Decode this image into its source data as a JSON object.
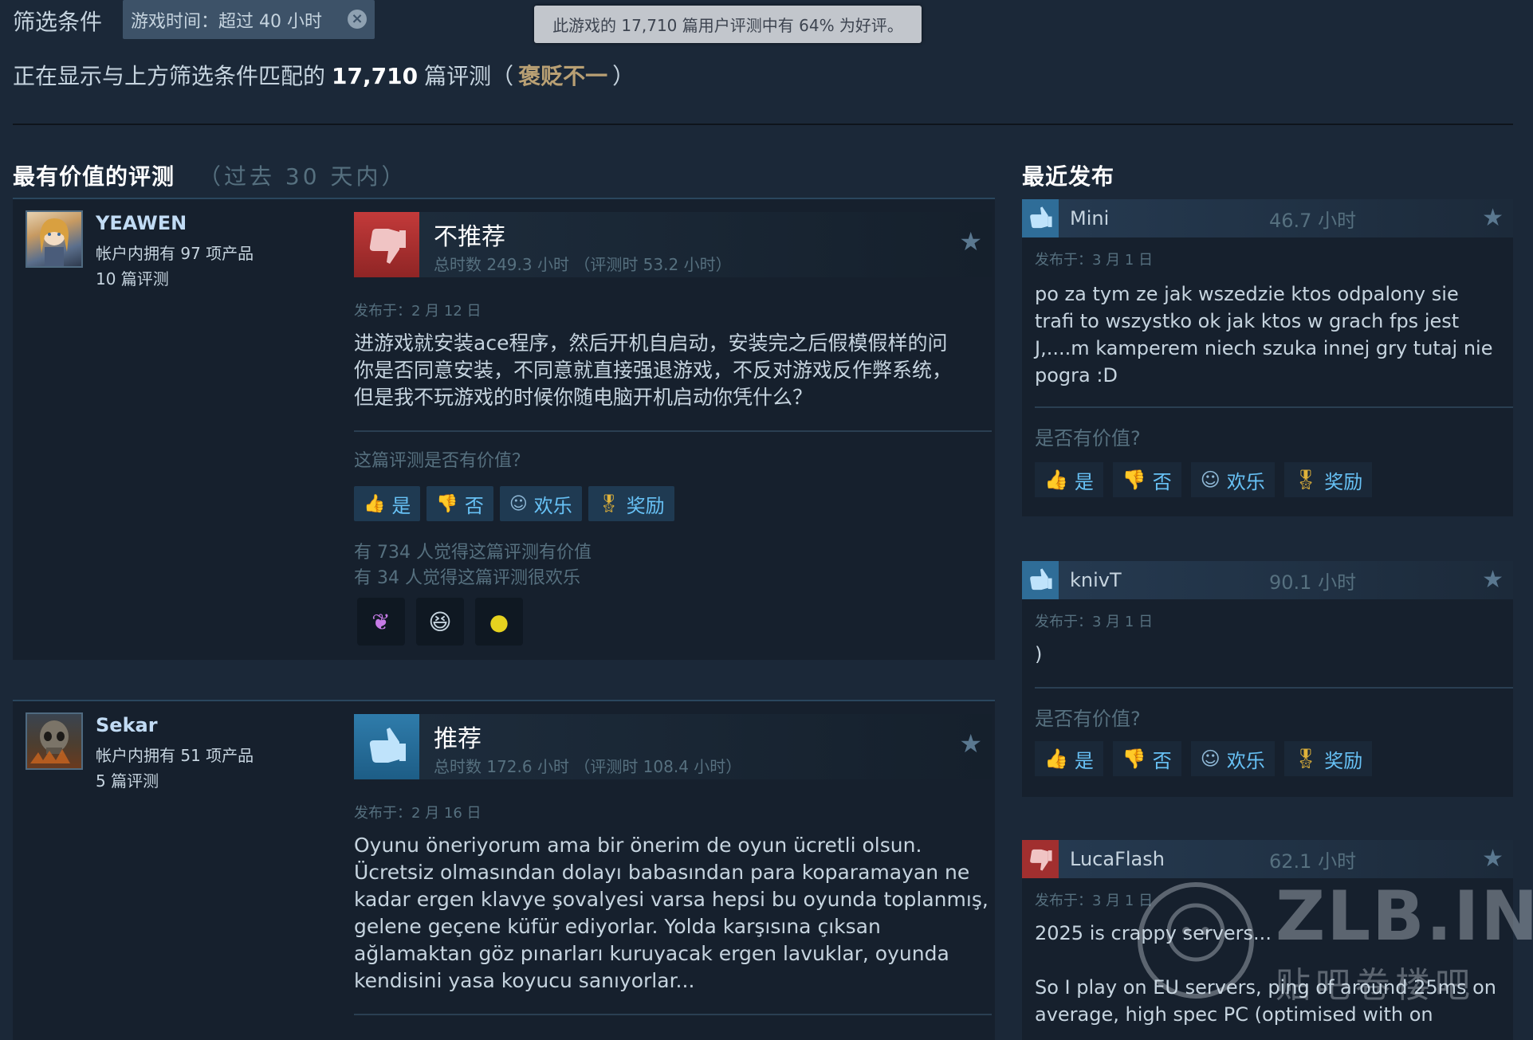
{
  "filter": {
    "label": "筛选条件",
    "chip": "游戏时间：超过 40 小时",
    "chip_close": "×"
  },
  "tooltip": "此游戏的 17,710 篇用户评测中有 64% 为好评。",
  "showing": {
    "prefix": "正在显示与上方筛选条件匹配的",
    "count": "17,710",
    "suffix": "篇评测（",
    "rating": "褒贬不一",
    "close": "）"
  },
  "sections": {
    "helpful_title": "最有价值的评测",
    "helpful_sub": "（过去 30 天内）",
    "recent_title": "最近发布"
  },
  "reviews": [
    {
      "username": "YEAWEN",
      "products": "帐户内拥有 97 项产品",
      "review_count": "10 篇评测",
      "verdict": "不推荐",
      "hours": "总时数 249.3 小时 （评测时 53.2 小时）",
      "posted": "发布于：2 月 12 日",
      "text": [
        "进游戏就安装ace程序，然后开机自启动，安装完之后假模假样的问",
        "你是否同意安装，不同意就直接强退游戏，不反对游戏反作弊系统，",
        "但是我不玩游戏的时候你随电脑开机启动你凭什么？"
      ],
      "helpful_q": "这篇评测是否有价值？",
      "helpful_stat": "有 734 人觉得这篇评测有价值",
      "funny_stat": "有 34 人觉得这篇评测很欢乐",
      "recommended": false
    },
    {
      "username": "Sekar",
      "products": "帐户内拥有 51 项产品",
      "review_count": "5 篇评测",
      "verdict": "推荐",
      "hours": "总时数 172.6 小时 （评测时 108.4 小时）",
      "posted": "发布于：2 月 16 日",
      "text": [
        "Oyunu öneriyorum ama bir önerim de oyun ücretli olsun.",
        "Ücretsiz olmasından dolayı babasından para koparamayan ne",
        "kadar ergen klavye şovalyesi varsa hepsi bu oyunda toplanmış,",
        "gelene geçene küfür ediyorlar. Yolda karşısına çıksan",
        "ağlamaktan göz pınarları kuruyacak ergen lavuklar, oyunda",
        "kendisini yasa koyucu sanıyorlar..."
      ],
      "recommended": true
    }
  ],
  "buttons": {
    "yes": "是",
    "no": "否",
    "funny": "欢乐",
    "award": "奖励"
  },
  "recent": [
    {
      "name": "Mini",
      "hours": "46.7 小时",
      "posted": "发布于：3 月 1 日",
      "text": [
        "po za tym ze jak wszedzie ktos odpalony sie",
        "trafi to wszystko ok jak ktos w grach fps jest",
        "J,....m kamperem niech szuka innej gry tutaj nie",
        "pogra :D"
      ],
      "helpful_q": "是否有价值?",
      "recommended": true
    },
    {
      "name": "knivT",
      "hours": "90.1 小时",
      "posted": "发布于：3 月 1 日",
      "text": [
        ")"
      ],
      "helpful_q": "是否有价值?",
      "recommended": true
    },
    {
      "name": "LucaFlash",
      "hours": "62.1 小时",
      "posted": "发布于：3 月 1 日",
      "text": [
        "2025 is crappy servers...",
        "",
        "So I play on EU servers, ping of around 25ms on",
        "average, high spec PC (optimised with on"
      ],
      "recommended": false
    }
  ],
  "watermark": {
    "main": "ZLB.INK",
    "sub": "贴吧卷楼吧"
  },
  "colors": {
    "background": "#1b2838",
    "link": "#67c1f5",
    "mixed": "#b9a074",
    "negative": "#a12f2f",
    "positive": "#2f6d98"
  }
}
